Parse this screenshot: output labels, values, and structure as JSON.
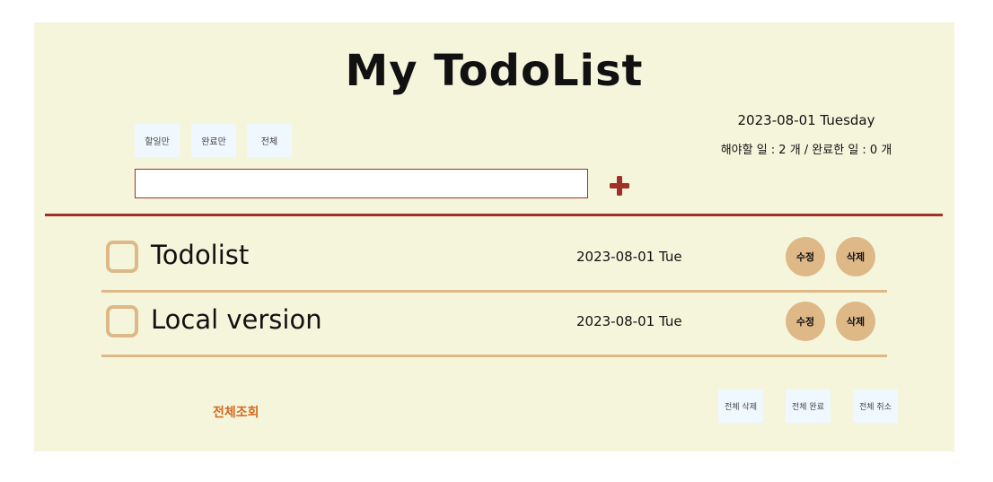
{
  "app": {
    "title": "My TodoList"
  },
  "filters": {
    "todo_only": "할일만",
    "done_only": "완료만",
    "all": "전체"
  },
  "info": {
    "date": "2023-08-01 Tuesday",
    "counts": "해야할 일 : 2 개  /  완료한 일 : 0 개"
  },
  "input": {
    "value": "",
    "placeholder": "",
    "add_icon": "plus-icon"
  },
  "todos": [
    {
      "text": "Todolist",
      "date": "2023-08-01 Tue",
      "checked": false,
      "edit_label": "수정",
      "delete_label": "삭제"
    },
    {
      "text": "Local version",
      "date": "2023-08-01 Tue",
      "checked": false,
      "edit_label": "수정",
      "delete_label": "삭제"
    }
  ],
  "footer": {
    "view_all": "전체조회",
    "delete_all": "전체 삭제",
    "complete_all": "전체 완료",
    "cancel_all": "전체 취소"
  },
  "colors": {
    "background": "#f5f5dc",
    "accent": "#a0302a",
    "item": "#deb887",
    "button_bg": "#f0f8ff",
    "link": "#d2691e"
  }
}
